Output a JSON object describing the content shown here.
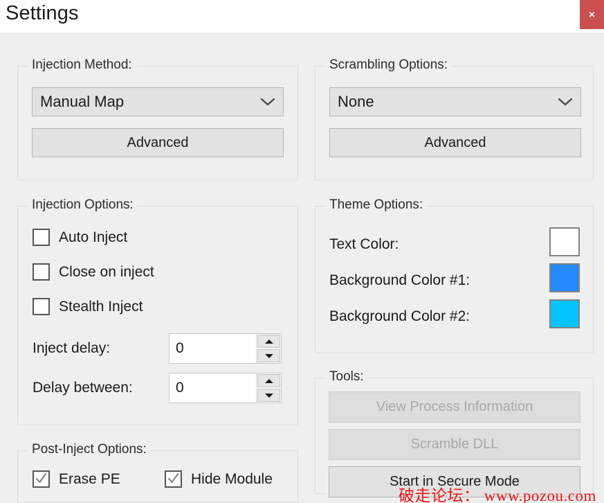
{
  "window": {
    "title": "Settings",
    "close_label": "×"
  },
  "groups": {
    "injection_method": {
      "legend": "Injection Method:",
      "combo_value": "Manual Map",
      "advanced_label": "Advanced"
    },
    "scrambling_options": {
      "legend": "Scrambling Options:",
      "combo_value": "None",
      "advanced_label": "Advanced"
    },
    "injection_options": {
      "legend": "Injection Options:",
      "checkboxes": [
        {
          "label": "Auto Inject",
          "checked": false
        },
        {
          "label": "Close on inject",
          "checked": false
        },
        {
          "label": "Stealth Inject",
          "checked": false
        }
      ],
      "fields": [
        {
          "label": "Inject delay:",
          "value": "0"
        },
        {
          "label": "Delay between:",
          "value": "0"
        }
      ]
    },
    "theme_options": {
      "legend": "Theme Options:",
      "rows": [
        {
          "label": "Text Color:",
          "color": "#ffffff"
        },
        {
          "label": "Background Color #1:",
          "color": "#2589fe"
        },
        {
          "label": "Background Color #2:",
          "color": "#05c3ff"
        }
      ]
    },
    "tools": {
      "legend": "Tools:",
      "buttons": [
        {
          "label": "View Process Information",
          "enabled": false
        },
        {
          "label": "Scramble DLL",
          "enabled": false
        },
        {
          "label": "Start in Secure Mode",
          "enabled": true
        }
      ]
    },
    "post_inject_options": {
      "legend": "Post-Inject Options:",
      "checkboxes": [
        {
          "label": "Erase PE",
          "checked": true
        },
        {
          "label": "Hide Module",
          "checked": true
        }
      ]
    }
  },
  "watermark": "破走论坛： www.pozou.com",
  "colors": {
    "window_bg": "#efeff0",
    "titlebar_bg": "#ffffff",
    "close_bg": "#c9504e",
    "control_bg": "#e2e2e2",
    "accent_blue": "#2589fe",
    "accent_cyan": "#05c3ff",
    "watermark_red": "#f01515"
  }
}
